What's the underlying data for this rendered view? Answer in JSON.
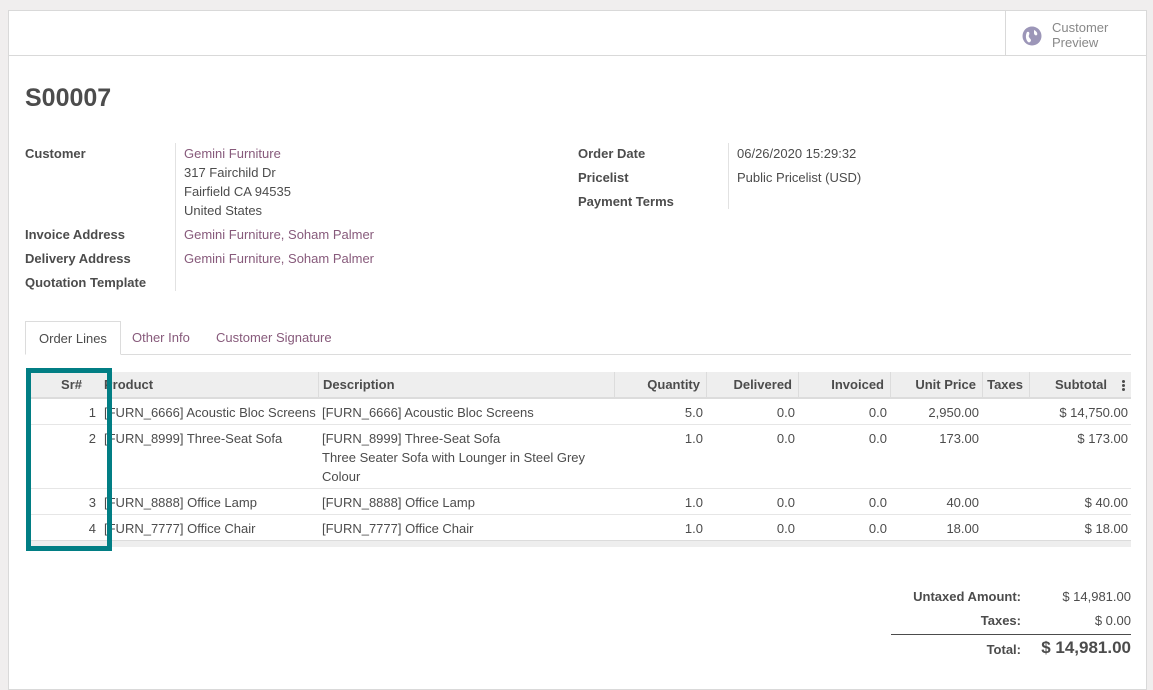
{
  "header": {
    "customer_preview": [
      "Customer",
      "Preview"
    ]
  },
  "order": {
    "name": "S00007",
    "customer_label": "Customer",
    "customer_name": "Gemini Furniture",
    "address_lines": [
      "317 Fairchild Dr",
      "Fairfield CA 94535",
      "United States"
    ],
    "invoice_label": "Invoice Address",
    "invoice_value": "Gemini Furniture, Soham Palmer",
    "delivery_label": "Delivery Address",
    "delivery_value": "Gemini Furniture, Soham Palmer",
    "template_label": "Quotation Template",
    "order_date_label": "Order Date",
    "order_date_value": "06/26/2020 15:29:32",
    "pricelist_label": "Pricelist",
    "pricelist_value": "Public Pricelist (USD)",
    "payment_terms_label": "Payment Terms"
  },
  "tabs": [
    "Order Lines",
    "Other Info",
    "Customer Signature"
  ],
  "table": {
    "columns": [
      "Sr#",
      "Product",
      "Description",
      "Quantity",
      "Delivered",
      "Invoiced",
      "Unit Price",
      "Taxes",
      "Subtotal"
    ],
    "rows": [
      {
        "sr": "1",
        "product": "[FURN_6666] Acoustic Bloc Screens",
        "description": [
          "[FURN_6666] Acoustic Bloc Screens"
        ],
        "quantity": "5.0",
        "delivered": "0.0",
        "invoiced": "0.0",
        "unit_price": "2,950.00",
        "taxes": "",
        "subtotal": "$ 14,750.00"
      },
      {
        "sr": "2",
        "product": "[FURN_8999] Three-Seat Sofa",
        "description": [
          "[FURN_8999] Three-Seat Sofa",
          "Three Seater Sofa with Lounger in Steel Grey",
          "Colour"
        ],
        "quantity": "1.0",
        "delivered": "0.0",
        "invoiced": "0.0",
        "unit_price": "173.00",
        "taxes": "",
        "subtotal": "$ 173.00"
      },
      {
        "sr": "3",
        "product": "[FURN_8888] Office Lamp",
        "description": [
          "[FURN_8888] Office Lamp"
        ],
        "quantity": "1.0",
        "delivered": "0.0",
        "invoiced": "0.0",
        "unit_price": "40.00",
        "taxes": "",
        "subtotal": "$ 40.00"
      },
      {
        "sr": "4",
        "product": "[FURN_7777] Office Chair",
        "description": [
          "[FURN_7777] Office Chair"
        ],
        "quantity": "1.0",
        "delivered": "0.0",
        "invoiced": "0.0",
        "unit_price": "18.00",
        "taxes": "",
        "subtotal": "$ 18.00"
      }
    ]
  },
  "totals": {
    "untaxed_label": "Untaxed Amount:",
    "untaxed_value": "$ 14,981.00",
    "taxes_label": "Taxes:",
    "taxes_value": "$ 0.00",
    "total_label": "Total:",
    "total_value": "$ 14,981.00"
  },
  "colors": {
    "link": "#875a7b",
    "highlight": "#017e84"
  },
  "icons": {
    "customer_preview": "globe-icon",
    "column_options": "kebab-icon"
  }
}
